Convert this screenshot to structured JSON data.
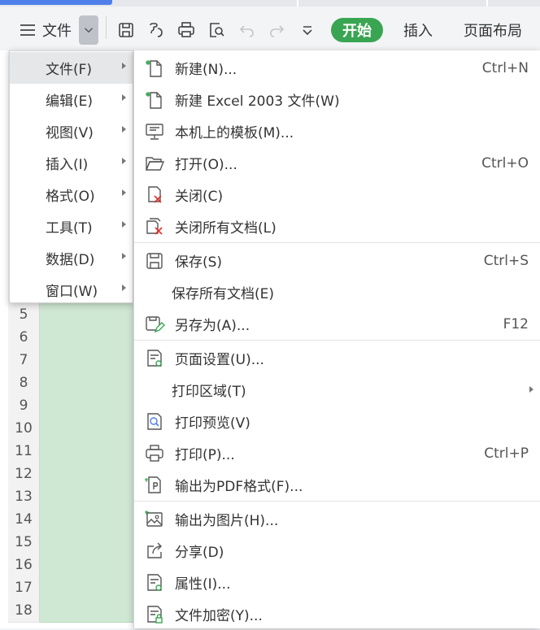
{
  "toolbar": {
    "file_label": "文件",
    "start_label": "开始",
    "insert_label": "插入",
    "page_layout_label": "页面布局",
    "icons": [
      "menu-icon",
      "save-icon",
      "format-painter-icon",
      "print-icon",
      "print-preview-icon",
      "undo-icon",
      "redo-icon",
      "more-icon"
    ]
  },
  "sheet": {
    "row_numbers": [
      "5",
      "6",
      "7",
      "8",
      "9",
      "10",
      "11",
      "12",
      "13",
      "14",
      "15",
      "16",
      "17",
      "18"
    ]
  },
  "main_menu": {
    "items": [
      {
        "label": "文件(F)",
        "has_submenu": true,
        "active": true
      },
      {
        "label": "编辑(E)",
        "has_submenu": true
      },
      {
        "label": "视图(V)",
        "has_submenu": true
      },
      {
        "label": "插入(I)",
        "has_submenu": true
      },
      {
        "label": "格式(O)",
        "has_submenu": true
      },
      {
        "label": "工具(T)",
        "has_submenu": true
      },
      {
        "label": "数据(D)",
        "has_submenu": true
      },
      {
        "label": "窗口(W)",
        "has_submenu": true
      }
    ]
  },
  "file_menu": {
    "items": [
      {
        "label": "新建(N)...",
        "shortcut": "Ctrl+N",
        "icon": "new-file-icon"
      },
      {
        "label": "新建 Excel 2003 文件(W)",
        "shortcut": "",
        "icon": "new-file-icon"
      },
      {
        "label": "本机上的模板(M)...",
        "shortcut": "",
        "icon": "template-icon"
      },
      {
        "label": "打开(O)...",
        "shortcut": "Ctrl+O",
        "icon": "open-folder-icon"
      },
      {
        "label": "关闭(C)",
        "shortcut": "",
        "icon": "close-doc-icon"
      },
      {
        "label": "关闭所有文档(L)",
        "shortcut": "",
        "icon": "close-all-icon"
      },
      {
        "label": "保存(S)",
        "shortcut": "Ctrl+S",
        "icon": "save-icon"
      },
      {
        "label": "保存所有文档(E)",
        "shortcut": "",
        "icon": ""
      },
      {
        "label": "另存为(A)...",
        "shortcut": "F12",
        "icon": "save-as-icon"
      },
      {
        "label": "页面设置(U)...",
        "shortcut": "",
        "icon": "page-setup-icon"
      },
      {
        "label": "打印区域(T)",
        "shortcut": "",
        "icon": "",
        "has_submenu": true
      },
      {
        "label": "打印预览(V)",
        "shortcut": "",
        "icon": "print-preview-icon"
      },
      {
        "label": "打印(P)...",
        "shortcut": "Ctrl+P",
        "icon": "print-icon"
      },
      {
        "label": "输出为PDF格式(F)...",
        "shortcut": "",
        "icon": "export-pdf-icon"
      },
      {
        "label": "输出为图片(H)...",
        "shortcut": "",
        "icon": "export-image-icon"
      },
      {
        "label": "分享(D)",
        "shortcut": "",
        "icon": "share-icon"
      },
      {
        "label": "属性(I)...",
        "shortcut": "",
        "icon": "properties-icon"
      },
      {
        "label": "文件加密(Y)...",
        "shortcut": "",
        "icon": "encrypt-icon"
      }
    ]
  },
  "colors": {
    "accent_green": "#39a553",
    "selected_cells": "#cfe8d3",
    "tab_blue": "#4f7fe8",
    "close_red": "#e0302b"
  }
}
